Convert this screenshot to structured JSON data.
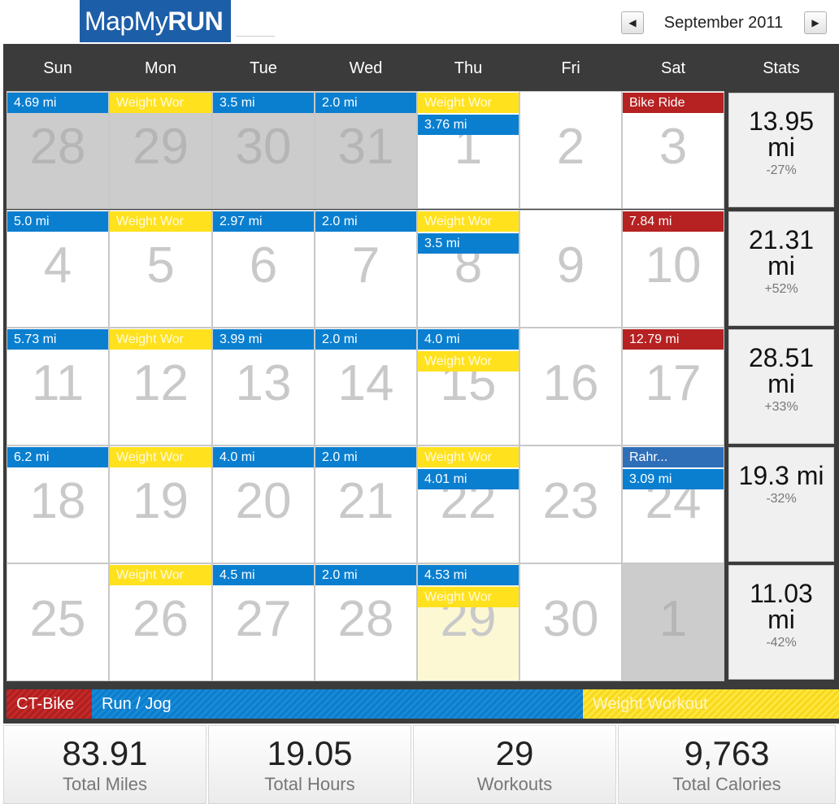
{
  "header": {
    "logo_map": "MapMy",
    "logo_run": "RUN",
    "month": "September 2011",
    "prev_icon": "◀",
    "next_icon": "▶"
  },
  "calendar": {
    "day_headers": [
      "Sun",
      "Mon",
      "Tue",
      "Wed",
      "Thu",
      "Fri",
      "Sat"
    ],
    "stats_header": "Stats",
    "weeks": [
      {
        "days": [
          {
            "num": "28",
            "other": true,
            "events": [
              {
                "label": "4.69 mi",
                "type": "run"
              }
            ]
          },
          {
            "num": "29",
            "other": true,
            "events": [
              {
                "label": "Weight Wor",
                "type": "weight"
              }
            ]
          },
          {
            "num": "30",
            "other": true,
            "events": [
              {
                "label": "3.5 mi",
                "type": "run"
              }
            ]
          },
          {
            "num": "31",
            "other": true,
            "events": [
              {
                "label": "2.0 mi",
                "type": "run"
              }
            ]
          },
          {
            "num": "1",
            "events": [
              {
                "label": "Weight Wor",
                "type": "weight"
              },
              {
                "label": "3.76 mi",
                "type": "run"
              }
            ]
          },
          {
            "num": "2",
            "events": []
          },
          {
            "num": "3",
            "events": [
              {
                "label": "Bike Ride",
                "type": "bike"
              }
            ]
          }
        ],
        "stats": {
          "value": "13.95 mi",
          "change": "-27%"
        }
      },
      {
        "days": [
          {
            "num": "4",
            "events": [
              {
                "label": "5.0 mi",
                "type": "run"
              }
            ]
          },
          {
            "num": "5",
            "events": [
              {
                "label": "Weight Wor",
                "type": "weight"
              }
            ]
          },
          {
            "num": "6",
            "events": [
              {
                "label": "2.97 mi",
                "type": "run"
              }
            ]
          },
          {
            "num": "7",
            "events": [
              {
                "label": "2.0 mi",
                "type": "run"
              }
            ]
          },
          {
            "num": "8",
            "events": [
              {
                "label": "Weight Wor",
                "type": "weight"
              },
              {
                "label": "3.5 mi",
                "type": "run"
              }
            ]
          },
          {
            "num": "9",
            "events": []
          },
          {
            "num": "10",
            "events": [
              {
                "label": "7.84 mi",
                "type": "bike"
              }
            ]
          }
        ],
        "stats": {
          "value": "21.31 mi",
          "change": "+52%"
        }
      },
      {
        "days": [
          {
            "num": "11",
            "events": [
              {
                "label": "5.73 mi",
                "type": "run"
              }
            ]
          },
          {
            "num": "12",
            "events": [
              {
                "label": "Weight Wor",
                "type": "weight"
              }
            ]
          },
          {
            "num": "13",
            "events": [
              {
                "label": "3.99 mi",
                "type": "run"
              }
            ]
          },
          {
            "num": "14",
            "events": [
              {
                "label": "2.0 mi",
                "type": "run"
              }
            ]
          },
          {
            "num": "15",
            "events": [
              {
                "label": "4.0 mi",
                "type": "run"
              },
              {
                "label": "Weight Wor",
                "type": "weight"
              }
            ]
          },
          {
            "num": "16",
            "events": []
          },
          {
            "num": "17",
            "events": [
              {
                "label": "12.79 mi",
                "type": "bike"
              }
            ]
          }
        ],
        "stats": {
          "value": "28.51 mi",
          "change": "+33%"
        }
      },
      {
        "days": [
          {
            "num": "18",
            "events": [
              {
                "label": "6.2 mi",
                "type": "run"
              }
            ]
          },
          {
            "num": "19",
            "events": [
              {
                "label": "Weight Wor",
                "type": "weight"
              }
            ]
          },
          {
            "num": "20",
            "events": [
              {
                "label": "4.0 mi",
                "type": "run"
              }
            ]
          },
          {
            "num": "21",
            "events": [
              {
                "label": "2.0 mi",
                "type": "run"
              }
            ]
          },
          {
            "num": "22",
            "events": [
              {
                "label": "Weight Wor",
                "type": "weight"
              },
              {
                "label": "4.01 mi",
                "type": "run"
              }
            ]
          },
          {
            "num": "23",
            "events": []
          },
          {
            "num": "24",
            "events": [
              {
                "label": "Rahr...",
                "type": "other"
              },
              {
                "label": "3.09 mi",
                "type": "run"
              }
            ]
          }
        ],
        "stats": {
          "value": "19.3 mi",
          "change": "-32%"
        }
      },
      {
        "days": [
          {
            "num": "25",
            "events": []
          },
          {
            "num": "26",
            "events": [
              {
                "label": "Weight Wor",
                "type": "weight"
              }
            ]
          },
          {
            "num": "27",
            "events": [
              {
                "label": "4.5 mi",
                "type": "run"
              }
            ]
          },
          {
            "num": "28",
            "events": [
              {
                "label": "2.0 mi",
                "type": "run"
              }
            ]
          },
          {
            "num": "29",
            "today": true,
            "events": [
              {
                "label": "4.53 mi",
                "type": "run"
              },
              {
                "label": "Weight Wor",
                "type": "weight"
              }
            ]
          },
          {
            "num": "30",
            "events": []
          },
          {
            "num": "1",
            "other": true,
            "events": []
          }
        ],
        "stats": {
          "value": "11.03 mi",
          "change": "-42%"
        }
      }
    ]
  },
  "legend": {
    "bike": "CT-Bike",
    "run": "Run / Jog",
    "weight": "Weight Workout"
  },
  "totals": [
    {
      "value": "83.91",
      "label": "Total Miles"
    },
    {
      "value": "19.05",
      "label": "Total Hours"
    },
    {
      "value": "29",
      "label": "Workouts"
    },
    {
      "value": "9,763",
      "label": "Total Calories"
    }
  ],
  "colors": {
    "run": "#0a7fd0",
    "weight": "#ffe11e",
    "bike": "#b62121",
    "other": "#2f6fb8",
    "brand": "#1d5ea8",
    "frame": "#3b3b3b"
  }
}
